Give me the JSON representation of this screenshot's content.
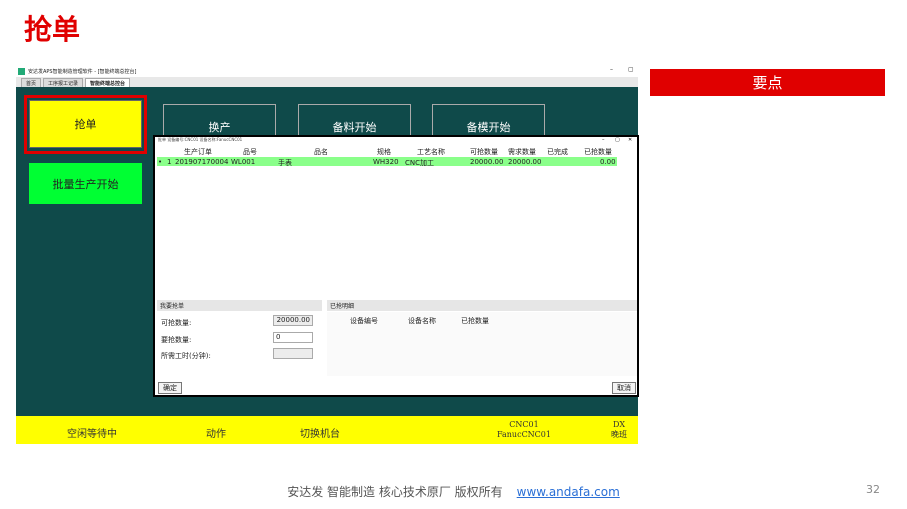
{
  "slide": {
    "title": "抢单",
    "key_banner": "要点",
    "footer_text": "安达发  智能制造 核心技术原厂   版权所有",
    "footer_link": "www.andafa.com",
    "page_number": "32"
  },
  "window": {
    "title": "安达发APS智能制造管理软件 - [智能终端总控台]",
    "min_label": "–",
    "max_label": "▢"
  },
  "tabs": [
    {
      "label": "首页",
      "active": false
    },
    {
      "label": "工序报工记录",
      "active": false
    },
    {
      "label": "智能终端总控台",
      "active": true
    }
  ],
  "left_buttons": {
    "grab": "抢单",
    "batch": "批量生产开始"
  },
  "top_buttons": [
    "换产",
    "备料开始",
    "备模开始"
  ],
  "dialog": {
    "title": "批单 设备编号:CNC01 设备名称:FanucCNC01",
    "min_label": "–",
    "max_label": "▢",
    "close_label": "✕",
    "columns": [
      "生产订单",
      "品号",
      "品名",
      "规格",
      "工艺名称",
      "可抢数量",
      "需求数量",
      "已完成",
      "已抢数量"
    ],
    "rows": [
      {
        "marker": "•",
        "index": "1",
        "order": "201907170004",
        "item_no": "WL001",
        "item_name": "手表",
        "spec": "WH320",
        "process": "CNC加工",
        "available": "20000.00",
        "demand": "20000.00",
        "done": "",
        "grabbed": "0.00"
      }
    ],
    "my_grab": {
      "header": "我要抢单",
      "available_label": "可抢数量:",
      "available_value": "20000.00",
      "want_label": "要抢数量:",
      "want_value": "0",
      "hours_label": "所需工时(分钟):",
      "hours_value": ""
    },
    "grabbed_detail": {
      "header": "已抢明细",
      "columns": [
        "设备编号",
        "设备名称",
        "已抢数量"
      ]
    },
    "confirm_label": "确定",
    "cancel_label": "取消"
  },
  "status_bar": {
    "state": "空闲等待中",
    "action": "动作",
    "switch": "切换机台",
    "machine_code": "CNC01",
    "machine_name": "FanucCNC01",
    "shift_code": "DX",
    "shift_name": "晚班"
  },
  "colors": {
    "accent_red": "#e00000",
    "app_bg": "#0f4a4a",
    "grab_yellow": "#ffff00",
    "batch_green": "#00ff33",
    "row_highlight": "#8aff8a"
  }
}
